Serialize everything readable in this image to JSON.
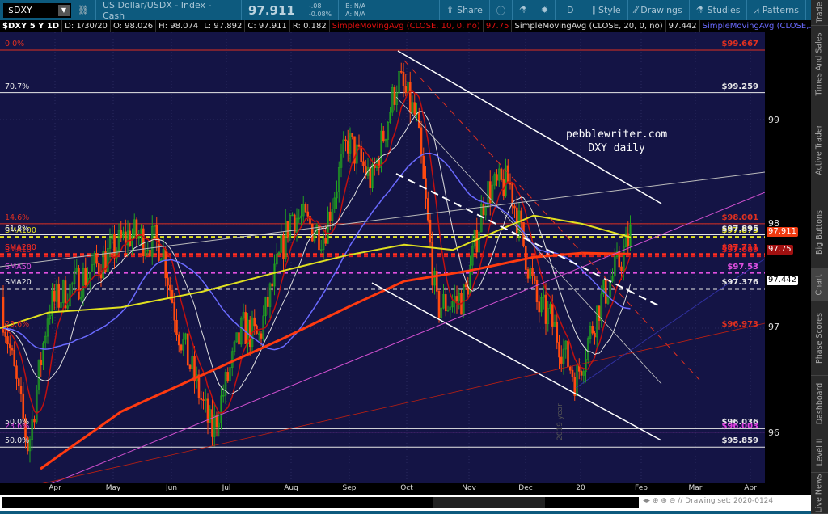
{
  "toolbar": {
    "symbol": "$DXY",
    "description": "US Dollar/USDX - Index - Cash",
    "last": "97.911",
    "change": "-.08",
    "change_pct": "-0.08%",
    "bid": "B: N/A",
    "ask": "A: N/A",
    "share": "Share",
    "period": "D",
    "style": "Style",
    "drawings": "Drawings",
    "studies": "Studies",
    "patterns": "Patterns"
  },
  "header": {
    "title": "$DXY 5 Y 1D",
    "date": "D: 1/30/20",
    "open": "O: 98.026",
    "high": "H: 98.074",
    "low": "L: 97.892",
    "close": "C: 97.911",
    "range": "R: 0.182",
    "sma10": "SimpleMovingAvg (CLOSE, 10, 0, no)",
    "sma10_val": "97.75",
    "sma20": "SimpleMovingAvg (CLOSE, 20, 0, no)",
    "sma20_val": "97.442",
    "sma50": "SimpleMovingAvg (CLOSE,..."
  },
  "levels": [
    {
      "left": "0.0%",
      "right": "$99.667",
      "price": 99.667,
      "color": "#e03020",
      "dash": false
    },
    {
      "left": "70.7%",
      "right": "$99.259",
      "price": 99.259,
      "color": "#e8e8e8",
      "dash": false
    },
    {
      "left": "14.6%",
      "right": "$98.001",
      "price": 98.001,
      "color": "#e03020",
      "dash": false
    },
    {
      "left": "SMA100",
      "right": "$97.875",
      "price": 97.875,
      "color": "#e0e020",
      "dash": true
    },
    {
      "left": "61.8%",
      "right": "$97.895",
      "price": 97.895,
      "color": "#e8e8e8",
      "dash": false
    },
    {
      "left": "SMA200",
      "right": "$97.711",
      "price": 97.711,
      "color": "#ff3020",
      "dash": true
    },
    {
      "left": "SMA10",
      "right": "$97.689",
      "price": 97.689,
      "color": "#e02020",
      "dash": true
    },
    {
      "left": "SMA50",
      "right": "$97.53",
      "price": 97.53,
      "color": "#e050e0",
      "dash": true
    },
    {
      "left": "SMA20",
      "right": "$97.376",
      "price": 97.376,
      "color": "#e8e8e8",
      "dash": true
    },
    {
      "left": "23.6%",
      "right": "$96.973",
      "price": 96.973,
      "color": "#e03020",
      "dash": false
    },
    {
      "left": "50.0%",
      "right": "$96.036",
      "price": 96.036,
      "color": "#e8e8e8",
      "dash": false
    },
    {
      "left": "23.6%",
      "right": "$96.003",
      "price": 96.003,
      "color": "#e040e0",
      "dash": false
    },
    {
      "left": "50.0%",
      "right": "$95.859",
      "price": 95.859,
      "color": "#e8e8e8",
      "dash": false
    }
  ],
  "axis": {
    "ticks": [
      "99",
      "98",
      "97",
      "96"
    ],
    "last_badge": "97.911",
    "sma10_badge": "97.75",
    "sma20_badge": "97.442"
  },
  "watermark": {
    "line1": "pebblewriter.com",
    "line2": "DXY daily"
  },
  "year_label": "2019 year",
  "dates": [
    "Apr",
    "May",
    "Jun",
    "Jul",
    "Aug",
    "Sep",
    "Oct",
    "Nov",
    "Dec",
    "20",
    "Feb",
    "Mar",
    "Apr"
  ],
  "drawing_set": "Drawing set: 2020-0124",
  "sidebar": [
    "Trade",
    "Times And Sales",
    "Active Trader",
    "Big Buttons",
    "Chart",
    "Phase Scores",
    "Dashboard",
    "Level II",
    "Live News"
  ]
}
